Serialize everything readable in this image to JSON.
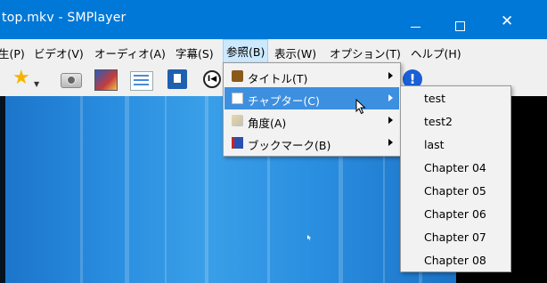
{
  "window": {
    "title": "top.mkv - SMPlayer",
    "close_glyph": "✕"
  },
  "menubar": {
    "items": [
      {
        "label": "生(P)",
        "active": false
      },
      {
        "label": "ビデオ(V)",
        "active": false
      },
      {
        "label": "オーディオ(A)",
        "active": false
      },
      {
        "label": "字幕(S)",
        "active": false
      },
      {
        "label": "参照(B)",
        "active": true
      },
      {
        "label": "表示(W)",
        "active": false
      },
      {
        "label": "オプション(T)",
        "active": false
      },
      {
        "label": "ヘルプ(H)",
        "active": false
      }
    ]
  },
  "toolbar": {
    "icons": [
      "favorites-star-icon",
      "screenshot-camera-icon",
      "picture-icon",
      "equalizer-icon",
      "film-icon",
      "previous-icon",
      "info-icon"
    ],
    "prev_glyph": "I◀",
    "info_glyph": "!"
  },
  "browse_menu": {
    "items": [
      {
        "label": "タイトル(T)",
        "icon": "title-book-icon",
        "highlighted": false
      },
      {
        "label": "チャプター(C)",
        "icon": "chapter-page-icon",
        "highlighted": true
      },
      {
        "label": "角度(A)",
        "icon": "angle-icon",
        "highlighted": false
      },
      {
        "label": "ブックマーク(B)",
        "icon": "bookmark-icon",
        "highlighted": false
      }
    ]
  },
  "chapter_submenu": {
    "items": [
      "test",
      "test2",
      "last",
      "Chapter 04",
      "Chapter 05",
      "Chapter 06",
      "Chapter 07",
      "Chapter 08"
    ]
  },
  "colors": {
    "titlebar": "#0078d7",
    "menu_highlight": "#3d8fe0",
    "menubar_active": "#cce8ff"
  }
}
